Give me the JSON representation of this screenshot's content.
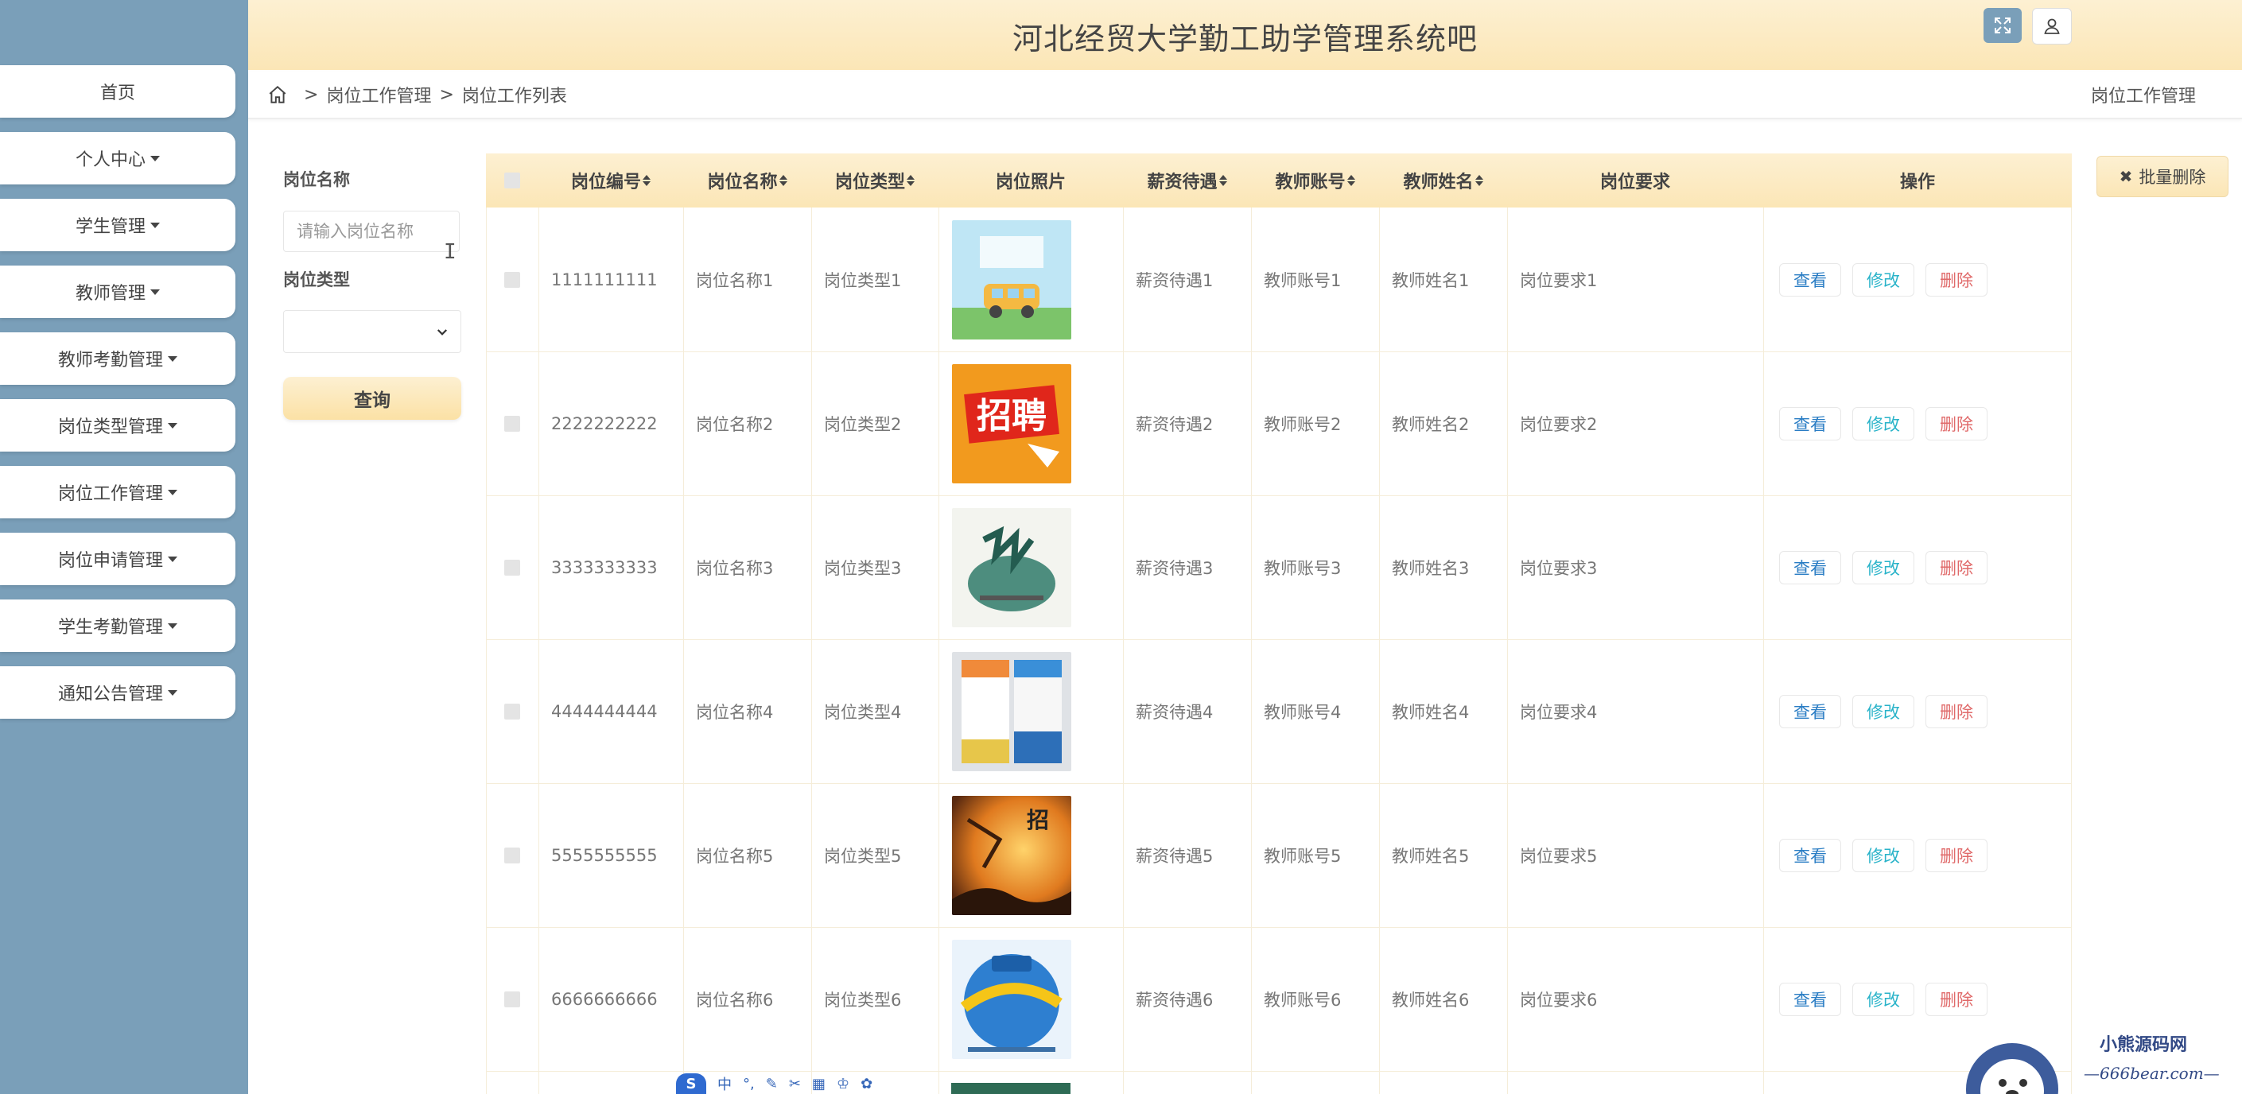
{
  "sidebar": {
    "items": [
      {
        "label": "首页",
        "caret": false
      },
      {
        "label": "个人中心",
        "caret": true
      },
      {
        "label": "学生管理",
        "caret": true
      },
      {
        "label": "教师管理",
        "caret": true
      },
      {
        "label": "教师考勤管理",
        "caret": true
      },
      {
        "label": "岗位类型管理",
        "caret": true
      },
      {
        "label": "岗位工作管理",
        "caret": true
      },
      {
        "label": "岗位申请管理",
        "caret": true
      },
      {
        "label": "学生考勤管理",
        "caret": true
      },
      {
        "label": "通知公告管理",
        "caret": true
      }
    ]
  },
  "header": {
    "title": "河北经贸大学勤工助学管理系统吧"
  },
  "breadcrumb": {
    "level1": "岗位工作管理",
    "level2": "岗位工作列表",
    "right": "岗位工作管理"
  },
  "search": {
    "name_label": "岗位名称",
    "name_placeholder": "请输入岗位名称",
    "type_label": "岗位类型",
    "query_label": "查询"
  },
  "batch_delete_label": "批量删除",
  "table": {
    "columns": [
      "岗位编号",
      "岗位名称",
      "岗位类型",
      "岗位照片",
      "薪资待遇",
      "教师账号",
      "教师姓名",
      "岗位要求",
      "操作"
    ],
    "actions": {
      "view": "查看",
      "edit": "修改",
      "delete": "删除"
    },
    "rows": [
      {
        "code": "1111111111",
        "name": "岗位名称1",
        "type": "岗位类型1",
        "salary": "薪资待遇1",
        "account": "教师账号1",
        "teacher": "教师姓名1",
        "req": "岗位要求1"
      },
      {
        "code": "2222222222",
        "name": "岗位名称2",
        "type": "岗位类型2",
        "salary": "薪资待遇2",
        "account": "教师账号2",
        "teacher": "教师姓名2",
        "req": "岗位要求2"
      },
      {
        "code": "3333333333",
        "name": "岗位名称3",
        "type": "岗位类型3",
        "salary": "薪资待遇3",
        "account": "教师账号3",
        "teacher": "教师姓名3",
        "req": "岗位要求3"
      },
      {
        "code": "4444444444",
        "name": "岗位名称4",
        "type": "岗位类型4",
        "salary": "薪资待遇4",
        "account": "教师账号4",
        "teacher": "教师姓名4",
        "req": "岗位要求4"
      },
      {
        "code": "5555555555",
        "name": "岗位名称5",
        "type": "岗位类型5",
        "salary": "薪资待遇5",
        "account": "教师账号5",
        "teacher": "教师姓名5",
        "req": "岗位要求5"
      },
      {
        "code": "6666666666",
        "name": "岗位名称6",
        "type": "岗位类型6",
        "salary": "薪资待遇6",
        "account": "教师账号6",
        "teacher": "教师姓名6",
        "req": "岗位要求6"
      }
    ]
  },
  "photo_texts": [
    "招聘",
    "招"
  ],
  "ime": {
    "lang": "中"
  },
  "watermark": {
    "line1": "小熊源码网",
    "line2": "—666bear.com—"
  },
  "colors": {
    "sidebar": "#7a9fb9",
    "header": "#fbe6b6",
    "view": "#2a7dc4",
    "edit": "#29b3c9",
    "delete": "#e06a6a"
  }
}
